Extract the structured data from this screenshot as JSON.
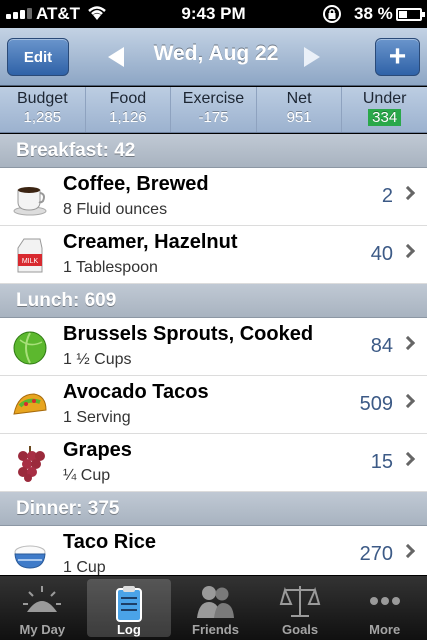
{
  "status_bar": {
    "carrier": "AT&T",
    "time": "9:43 PM",
    "battery": "38 %"
  },
  "nav": {
    "edit_label": "Edit",
    "date": "Wed, Aug 22",
    "add_label": "+"
  },
  "summary": [
    {
      "label": "Budget",
      "value": "1,285"
    },
    {
      "label": "Food",
      "value": "1,126"
    },
    {
      "label": "Exercise",
      "value": "-175"
    },
    {
      "label": "Net",
      "value": "951"
    },
    {
      "label": "Under",
      "value": "334"
    }
  ],
  "meals": [
    {
      "header": "Breakfast: 42",
      "items": [
        {
          "name": "Coffee, Brewed",
          "portion": "8 Fluid ounces",
          "calories": "2",
          "icon": "coffee-icon"
        },
        {
          "name": "Creamer, Hazelnut",
          "portion": "1 Tablespoon",
          "calories": "40",
          "icon": "milk-carton-icon"
        }
      ]
    },
    {
      "header": "Lunch: 609",
      "items": [
        {
          "name": "Brussels Sprouts, Cooked",
          "portion": "1 ½ Cups",
          "calories": "84",
          "icon": "lettuce-icon"
        },
        {
          "name": "Avocado Tacos",
          "portion": "1 Serving",
          "calories": "509",
          "icon": "taco-icon"
        },
        {
          "name": "Grapes",
          "portion": "¼ Cup",
          "calories": "15",
          "icon": "grapes-icon"
        }
      ]
    },
    {
      "header": "Dinner: 375",
      "items": [
        {
          "name": "Taco Rice",
          "portion": "1 Cup",
          "calories": "270",
          "icon": "rice-bowl-icon"
        }
      ]
    }
  ],
  "tabs": [
    {
      "label": "My Day",
      "icon": "sunrise-icon"
    },
    {
      "label": "Log",
      "icon": "clipboard-icon",
      "active": true
    },
    {
      "label": "Friends",
      "icon": "friends-icon"
    },
    {
      "label": "Goals",
      "icon": "scale-icon"
    },
    {
      "label": "More",
      "icon": "more-dots-icon"
    }
  ],
  "colors": {
    "under_badge": "#2aa84a",
    "nav_button": "#3a6db3",
    "calorie_text": "#3c5a86"
  }
}
